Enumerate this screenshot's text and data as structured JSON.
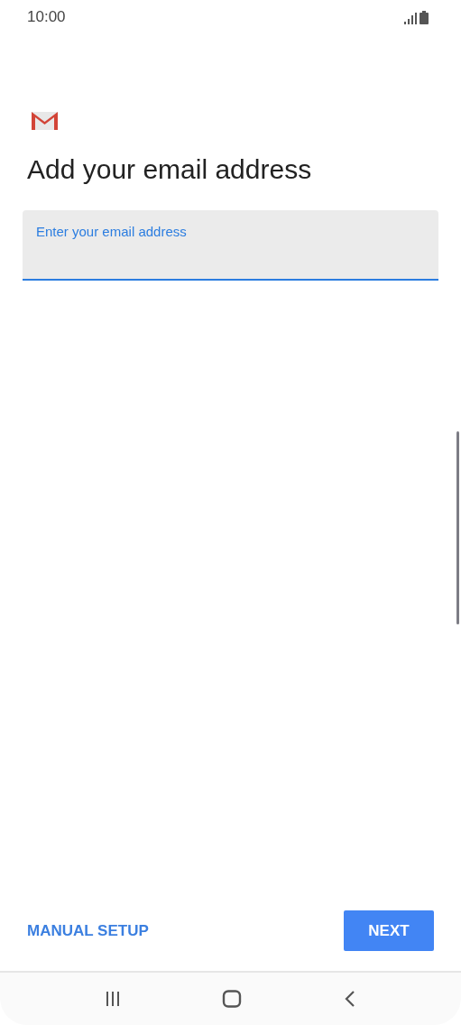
{
  "status_bar": {
    "time": "10:00"
  },
  "title": "Add your email address",
  "email_field": {
    "label": "Enter your email address",
    "focused": true
  },
  "actions": [
    {
      "label": "MANUAL SETUP",
      "kind": "text"
    },
    {
      "label": "NEXT",
      "kind": "filled"
    }
  ]
}
